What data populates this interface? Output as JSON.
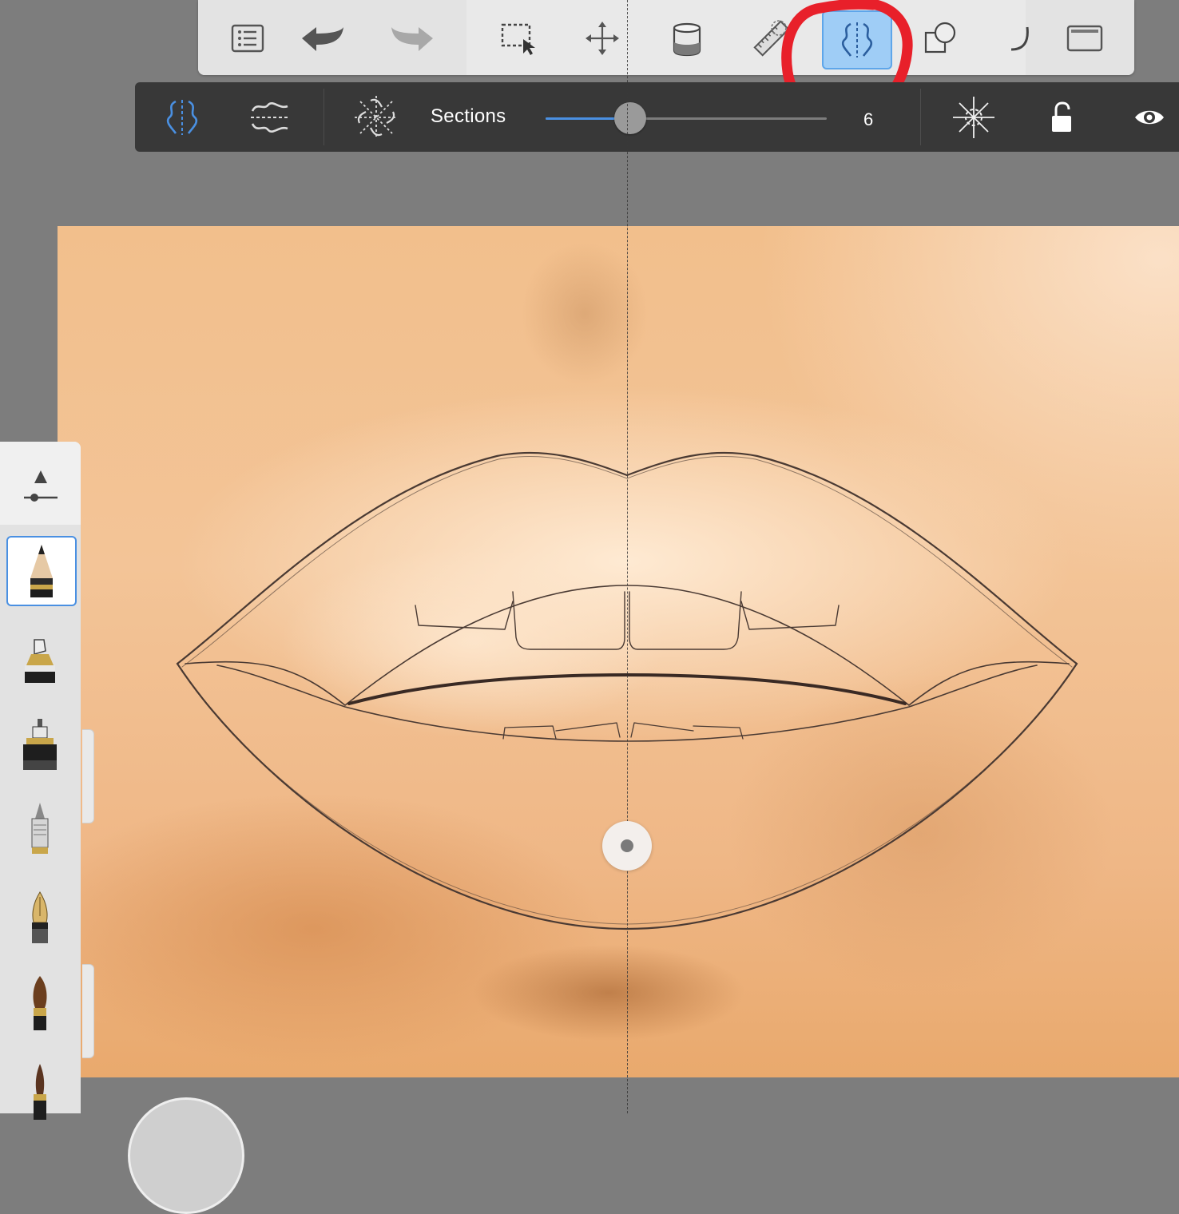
{
  "top_toolbar": {
    "tools": [
      {
        "name": "list-icon",
        "active": false
      },
      {
        "name": "undo-icon",
        "active": false
      },
      {
        "name": "redo-icon",
        "active": false
      },
      {
        "name": "selection-icon",
        "active": false
      },
      {
        "name": "transform-move-icon",
        "active": false
      },
      {
        "name": "paint-bucket-icon",
        "active": false
      },
      {
        "name": "ruler-guides-icon",
        "active": false
      },
      {
        "name": "symmetry-icon",
        "active": true
      },
      {
        "name": "shapes-icon",
        "active": false
      },
      {
        "name": "curve-icon",
        "active": false
      },
      {
        "name": "fullscreen-icon",
        "active": false
      }
    ]
  },
  "symmetry_bar": {
    "modes": [
      "vertical-symmetry-icon",
      "horizontal-symmetry-icon",
      "radial-symmetry-icon"
    ],
    "sections_label": "Sections",
    "sections_value": "6",
    "slider_fraction": 0.3,
    "right_tools": [
      "recenter-icon",
      "unlock-icon",
      "visibility-eye-icon"
    ]
  },
  "brushes": [
    "pencil-brush",
    "marker-brush",
    "technical-pen-brush",
    "ballpoint-pen-brush",
    "fountain-pen-brush",
    "paint-brush",
    "ink-brush"
  ],
  "colors": {
    "accent": "#4a90e2",
    "annotation": "#e8202a",
    "skin_base": "#f2bf8c"
  }
}
